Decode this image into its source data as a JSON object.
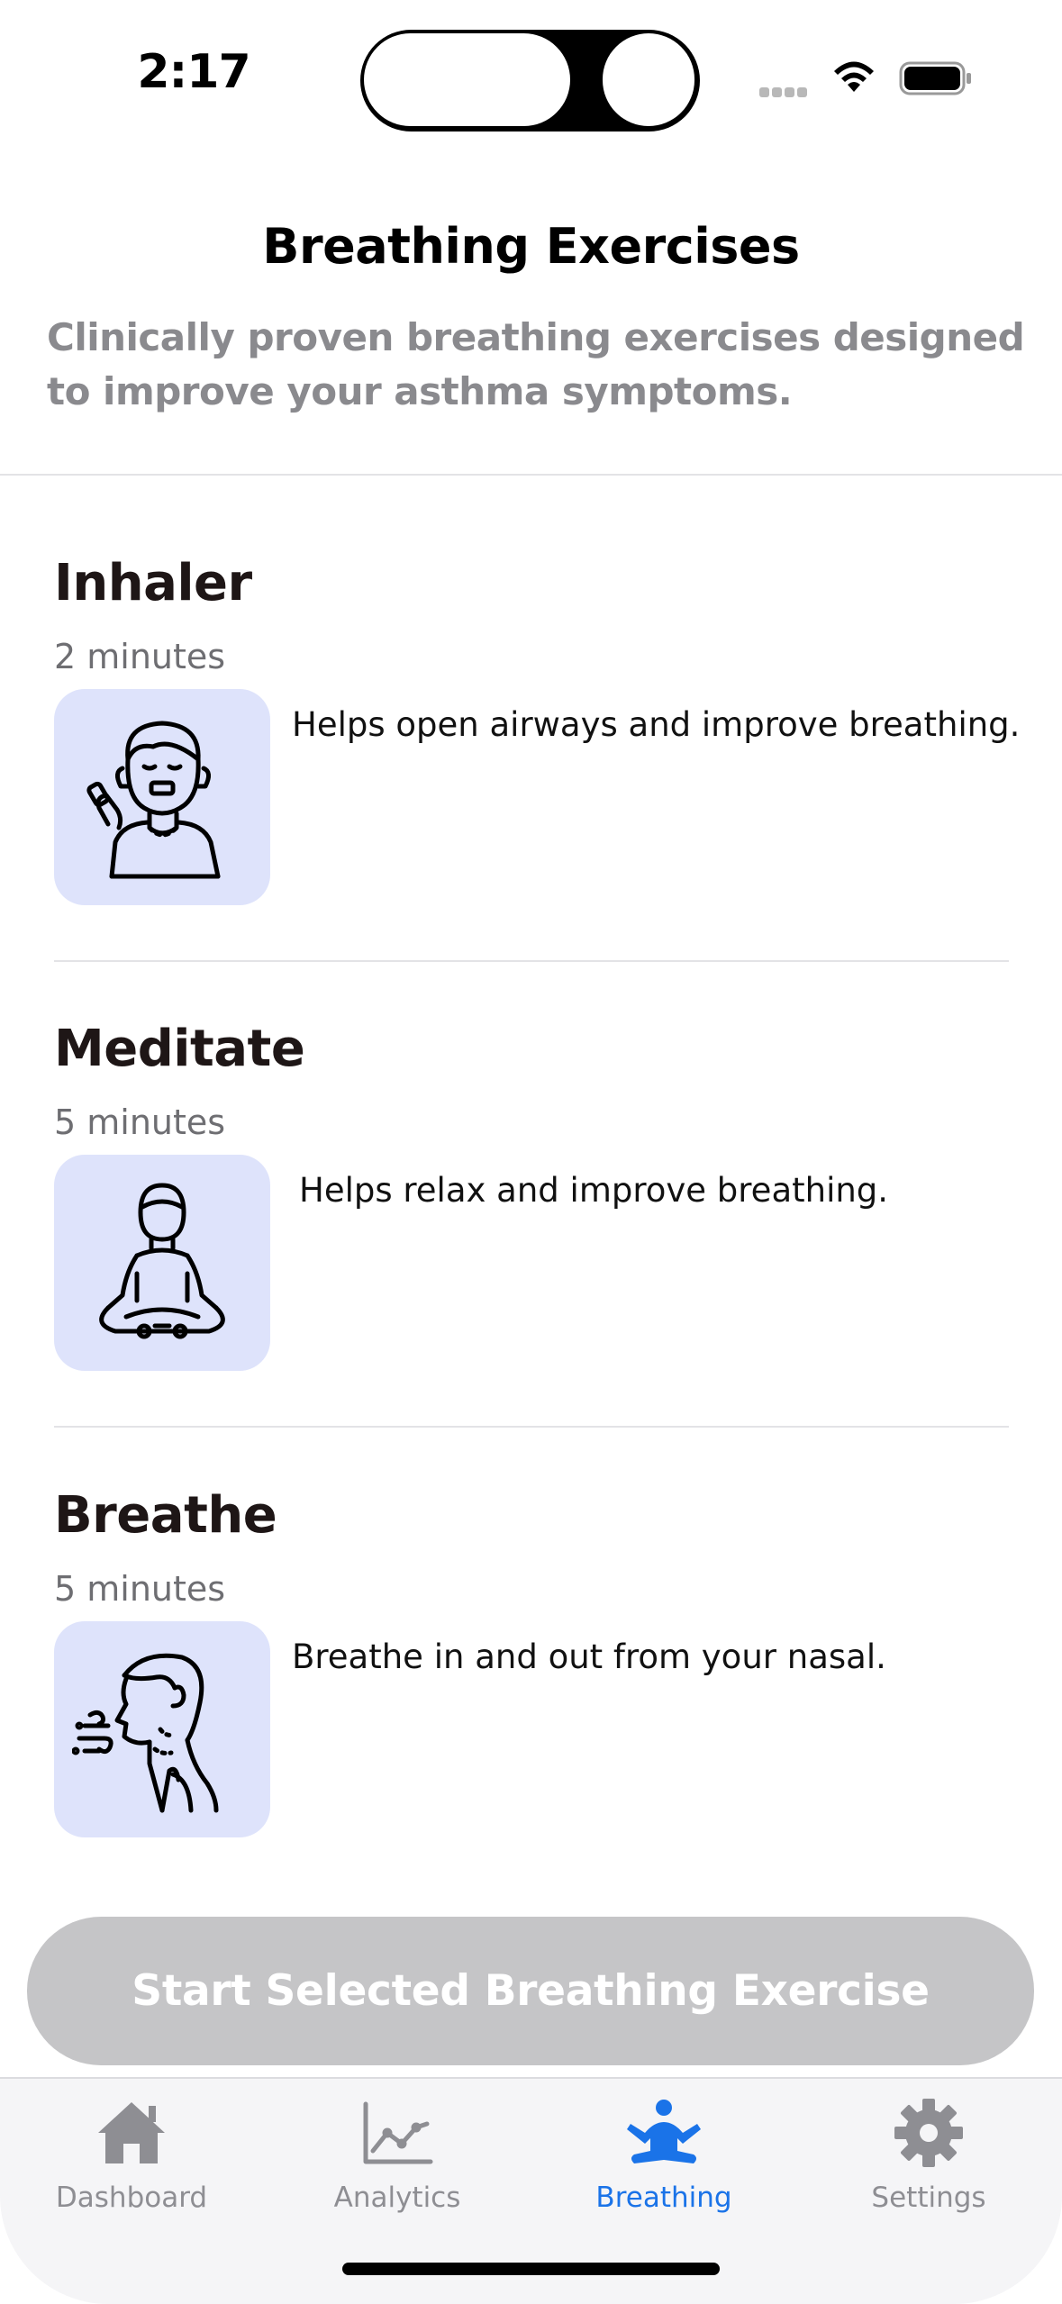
{
  "status_bar": {
    "time": "2:17"
  },
  "header": {
    "title": "Breathing Exercises",
    "subtitle": "Clinically proven breathing exercises designed to improve your asthma symptoms."
  },
  "exercises": [
    {
      "name": "Inhaler",
      "duration": "2 minutes",
      "description": "Helps open airways and improve breathing.",
      "icon": "inhaler-person-icon"
    },
    {
      "name": "Meditate",
      "duration": "5 minutes",
      "description": "Helps relax and improve breathing.",
      "icon": "meditation-person-icon"
    },
    {
      "name": "Breathe",
      "duration": "5 minutes",
      "description": "Breathe in and out from your nasal.",
      "icon": "exhale-person-icon"
    }
  ],
  "start_button": {
    "label": "Start Selected Breathing Exercise"
  },
  "tab_bar": {
    "tabs": [
      {
        "label": "Dashboard",
        "icon": "house-icon",
        "active": false
      },
      {
        "label": "Analytics",
        "icon": "line-chart-icon",
        "active": false
      },
      {
        "label": "Breathing",
        "icon": "meditation-icon",
        "active": true
      },
      {
        "label": "Settings",
        "icon": "gear-icon",
        "active": false
      }
    ]
  },
  "colors": {
    "accent": "#1a73e8",
    "thumb_background": "#dee3fb",
    "button_disabled": "#c5c5c7",
    "secondary_text": "#8a8a8e"
  }
}
